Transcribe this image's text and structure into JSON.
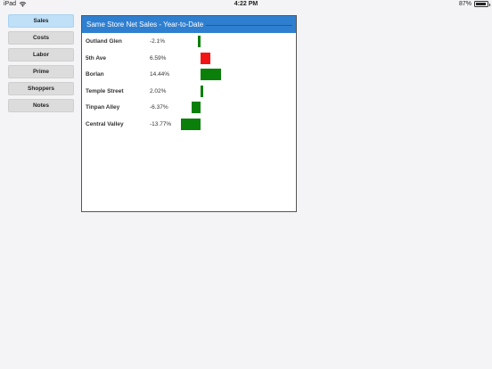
{
  "status_bar": {
    "device": "iPad",
    "time": "4:22 PM",
    "battery": "87%"
  },
  "sidebar": {
    "items": [
      {
        "label": "Sales",
        "active": true
      },
      {
        "label": "Costs",
        "active": false
      },
      {
        "label": "Labor",
        "active": false
      },
      {
        "label": "Prime",
        "active": false
      },
      {
        "label": "Shoppers",
        "active": false
      },
      {
        "label": "Notes",
        "active": false
      }
    ]
  },
  "panel": {
    "title": "Same Store Net Sales - Year-to-Date"
  },
  "chart_data": {
    "type": "bar",
    "orientation": "horizontal",
    "categories": [
      "Outland Glen",
      "5th Ave",
      "Borlan",
      "Temple Street",
      "Tinpan Alley",
      "Central Valley"
    ],
    "values": [
      -2.1,
      6.59,
      14.44,
      2.02,
      -6.37,
      -13.77
    ],
    "value_labels": [
      "-2.1%",
      "6.59%",
      "14.44%",
      "2.02%",
      "-6.37%",
      "-13.77%"
    ],
    "bar_colors": [
      "#0a7f0a",
      "#f21414",
      "#0a7f0a",
      "#0a7f0a",
      "#0a7f0a",
      "#0a7f0a"
    ]
  },
  "colors": {
    "header_blue": "#2f7fd0",
    "active_nav": "#bfe0f7",
    "nav_button": "#dcdcdc",
    "bar_green": "#0a7f0a",
    "bar_red": "#f21414"
  }
}
